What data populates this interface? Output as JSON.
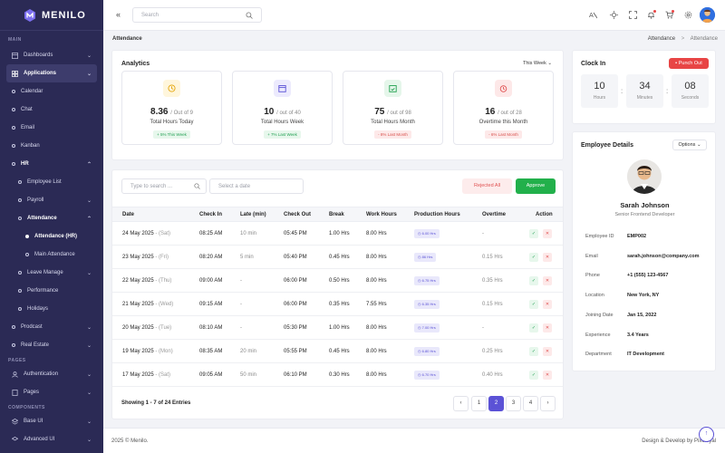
{
  "app": {
    "name": "MENILO"
  },
  "sidebar": {
    "sections": {
      "main": "MAIN",
      "pages": "PAGES",
      "components": "COMPONENTS"
    },
    "items": {
      "dashboards": "Dashboards",
      "applications": "Applications",
      "calendar": "Calendar",
      "chat": "Chat",
      "email": "Email",
      "kanban": "Kanban",
      "hr": "HR",
      "employee_list": "Employee List",
      "payroll": "Payroll",
      "attendance": "Attendance",
      "attendance_hr": "Attendance (HR)",
      "main_attendance": "Main Attendance",
      "leave_manage": "Leave Manage",
      "performance": "Performance",
      "holidays": "Holidays",
      "prodcast": "Prodcast",
      "real_estate": "Real Estate",
      "authentication": "Authentication",
      "pages": "Pages",
      "base_ui": "Base UI",
      "advanced_ui": "Advanced UI"
    }
  },
  "topbar": {
    "search_placeholder": "Search"
  },
  "breadcrumb": {
    "title": "Attendance",
    "parent": "Attendance",
    "separator": ">",
    "current": "Attendance"
  },
  "analytics": {
    "title": "Analytics",
    "filter": "This Week",
    "stats": [
      {
        "value": "8.36",
        "suffix": "/ Out of 9",
        "label": "Total Hours Today",
        "trend": "+ 5% This Week"
      },
      {
        "value": "10",
        "suffix": "/ out of 40",
        "label": "Total Hours Week",
        "trend": "+ 7% Last Week"
      },
      {
        "value": "75",
        "suffix": "/ out of 98",
        "label": "Total Hours Month",
        "trend": "- 8% Last Month"
      },
      {
        "value": "16",
        "suffix": "/ out of 28",
        "label": "Overtime this Month",
        "trend": "- 6% Last Month"
      }
    ]
  },
  "clock": {
    "title": "Clock In",
    "punch_label": "Punch Out",
    "hours": "10",
    "hours_label": "Hours",
    "minutes": "34",
    "minutes_label": "Minutes",
    "seconds": "08",
    "seconds_label": "Seconds"
  },
  "filters": {
    "search_placeholder": "Type to search ...",
    "date_placeholder": "Select a date",
    "reject_label": "Rejected All",
    "approve_label": "Approve"
  },
  "table": {
    "headers": {
      "date": "Date",
      "check_in": "Check In",
      "late": "Late (min)",
      "check_out": "Check Out",
      "break": "Break",
      "work": "Work Hours",
      "production": "Production Hours",
      "overtime": "Overtime",
      "action": "Action"
    },
    "rows": [
      {
        "date": "24 May 2025",
        "day": "- (Sat)",
        "check_in": "08:25 AM",
        "late": "10 min",
        "check_out": "05:45 PM",
        "break": "1.00 Hrs",
        "work": "8.00 Hrs",
        "production": "6.00 Hrs",
        "overtime": "-"
      },
      {
        "date": "23 May 2025",
        "day": "- (Fri)",
        "check_in": "08:20 AM",
        "late": "5 min",
        "check_out": "05:40 PM",
        "break": "0.45 Hrs",
        "work": "8.00 Hrs",
        "production": "86 Hrs",
        "overtime": "0.15 Hrs"
      },
      {
        "date": "22 May 2025",
        "day": "- (Thu)",
        "check_in": "09:00 AM",
        "late": "-",
        "check_out": "06:00 PM",
        "break": "0.50 Hrs",
        "work": "8.00 Hrs",
        "production": "6.75 Hrs",
        "overtime": "0.35 Hrs"
      },
      {
        "date": "21 May 2025",
        "day": "- (Wed)",
        "check_in": "09:15 AM",
        "late": "-",
        "check_out": "06:00 PM",
        "break": "0.35 Hrs",
        "work": "7.55 Hrs",
        "production": "6.35 Hrs",
        "overtime": "0.15 Hrs"
      },
      {
        "date": "20 May 2025",
        "day": "- (Tue)",
        "check_in": "08:10 AM",
        "late": "-",
        "check_out": "05:30 PM",
        "break": "1.00 Hrs",
        "work": "8.00 Hrs",
        "production": "7.00 Hrs",
        "overtime": "-"
      },
      {
        "date": "19 May 2025",
        "day": "- (Mon)",
        "check_in": "08:35 AM",
        "late": "20 min",
        "check_out": "05:55 PM",
        "break": "0.45 Hrs",
        "work": "8.00 Hrs",
        "production": "6.80 Hrs",
        "overtime": "0.25 Hrs"
      },
      {
        "date": "17 May 2025",
        "day": "- (Sat)",
        "check_in": "09:05 AM",
        "late": "50 min",
        "check_out": "06:10 PM",
        "break": "0.30 Hrs",
        "work": "8.00 Hrs",
        "production": "6.70 Hrs",
        "overtime": "0.40 Hrs"
      }
    ],
    "showing": "Showing 1 - 7 of 24 Entries",
    "pages": [
      "1",
      "2",
      "3",
      "4"
    ],
    "prev": "‹",
    "next": "›",
    "approve_glyph": "✓",
    "reject_glyph": "✕"
  },
  "employee": {
    "title": "Employee Details",
    "options": "Options",
    "name": "Sarah Johnson",
    "role": "Senior Frontend Developer",
    "fields": [
      {
        "label": "Employee ID",
        "value": "EMP002"
      },
      {
        "label": "Email",
        "value": "sarah.johnson@company.com"
      },
      {
        "label": "Phone",
        "value": "+1 (555) 123-4567"
      },
      {
        "label": "Location",
        "value": "New York, NY"
      },
      {
        "label": "Joining Date",
        "value": "Jan 15, 2022"
      },
      {
        "label": "Experience",
        "value": "3.4 Years"
      },
      {
        "label": "Department",
        "value": "IT Development"
      }
    ]
  },
  "footer": {
    "copyright": "2025 © Menilo.",
    "credit": "Design & Develop by Pixeloyal"
  },
  "colors": {
    "primary": "#5b52d6",
    "sidebar": "#2b2a55",
    "success": "#22b04b",
    "danger": "#e84545"
  },
  "icons": [
    "menu-collapse-icon",
    "search-icon",
    "translate-icon",
    "sun-icon",
    "fullscreen-icon",
    "bell-icon",
    "cart-icon",
    "gear-icon",
    "clock-icon",
    "calendar-icon",
    "calendar-check-icon",
    "alarm-icon",
    "scroll-top-icon"
  ]
}
